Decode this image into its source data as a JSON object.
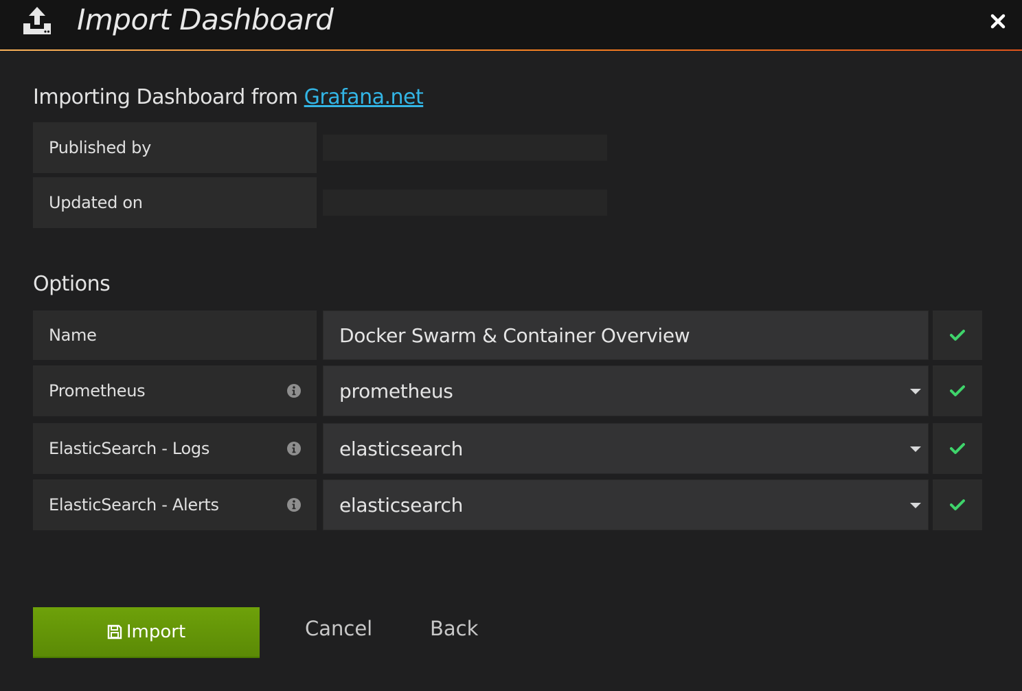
{
  "header": {
    "title": "Import Dashboard",
    "icon": "upload-icon",
    "close_icon": "close-icon"
  },
  "source": {
    "heading_prefix": "Importing Dashboard from",
    "link_text": "Grafana.net",
    "rows": [
      {
        "label": "Published by",
        "value": ""
      },
      {
        "label": "Updated on",
        "value": ""
      }
    ]
  },
  "options": {
    "heading": "Options",
    "name": {
      "label": "Name",
      "value": "Docker Swarm & Container Overview",
      "valid": true
    },
    "datasources": [
      {
        "label": "Prometheus",
        "selected": "prometheus",
        "valid": true
      },
      {
        "label": "ElasticSearch - Logs",
        "selected": "elasticsearch",
        "valid": true
      },
      {
        "label": "ElasticSearch - Alerts",
        "selected": "elasticsearch",
        "valid": true
      }
    ]
  },
  "actions": {
    "import_label": "Import",
    "cancel_label": "Cancel",
    "back_label": "Back"
  },
  "colors": {
    "accent_link": "#33b5e5",
    "success_check": "#3fd46b",
    "import_button": "#629e0b",
    "header_underline": "#f57f20"
  }
}
